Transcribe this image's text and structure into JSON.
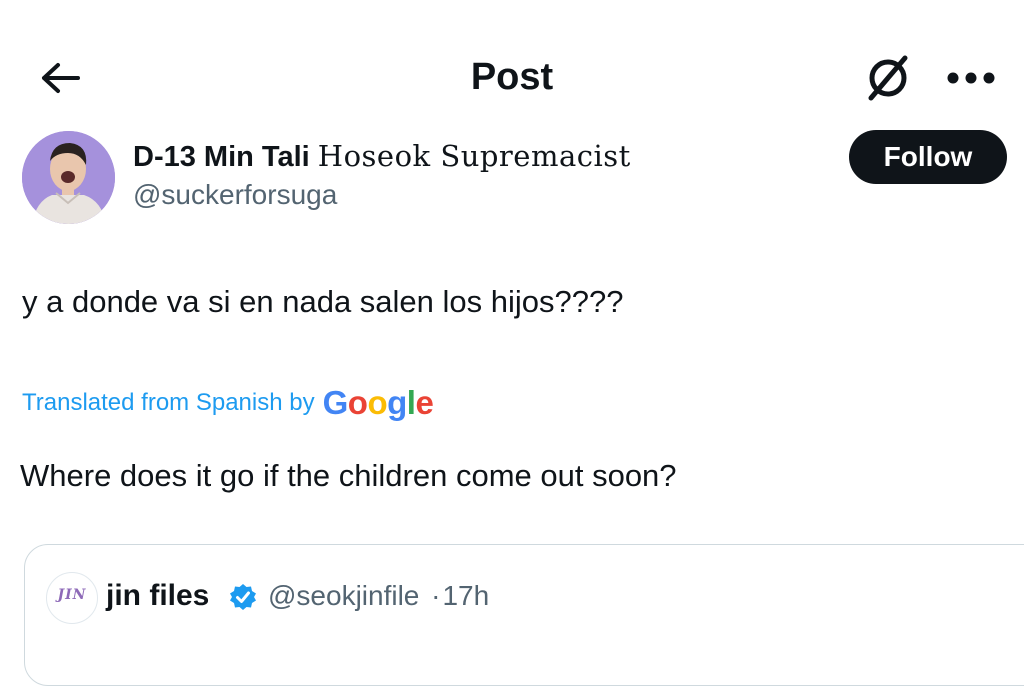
{
  "header": {
    "title": "Post",
    "back_icon": "arrow-left-icon",
    "grok_icon": "grok-icon",
    "more_icon": "more-horizontal-icon"
  },
  "author": {
    "display_name_bold": "D-13 Min Tali",
    "display_name_fancy": "Hoseok Supremacist",
    "handle": "@suckerforsuga",
    "follow_label": "Follow"
  },
  "tweet": {
    "text": "y a donde va si en nada salen los hijos????",
    "translated_label": "Translated from Spanish by",
    "translator_brand": "Google",
    "translation": "Where does it go if the children come out soon?"
  },
  "quoted": {
    "avatar_text": "JIN",
    "name": "jin files",
    "verified_icon": "verified-badge-icon",
    "handle": "@seokjinfile",
    "separator": "·",
    "time": "17h"
  },
  "colors": {
    "accent": "#1d9bf0",
    "text": "#0f1419",
    "secondary": "#536471",
    "border": "#cfd9de",
    "google_blue": "#4285f4",
    "google_red": "#ea4335",
    "google_yellow": "#fbbc05",
    "google_green": "#34a853"
  }
}
